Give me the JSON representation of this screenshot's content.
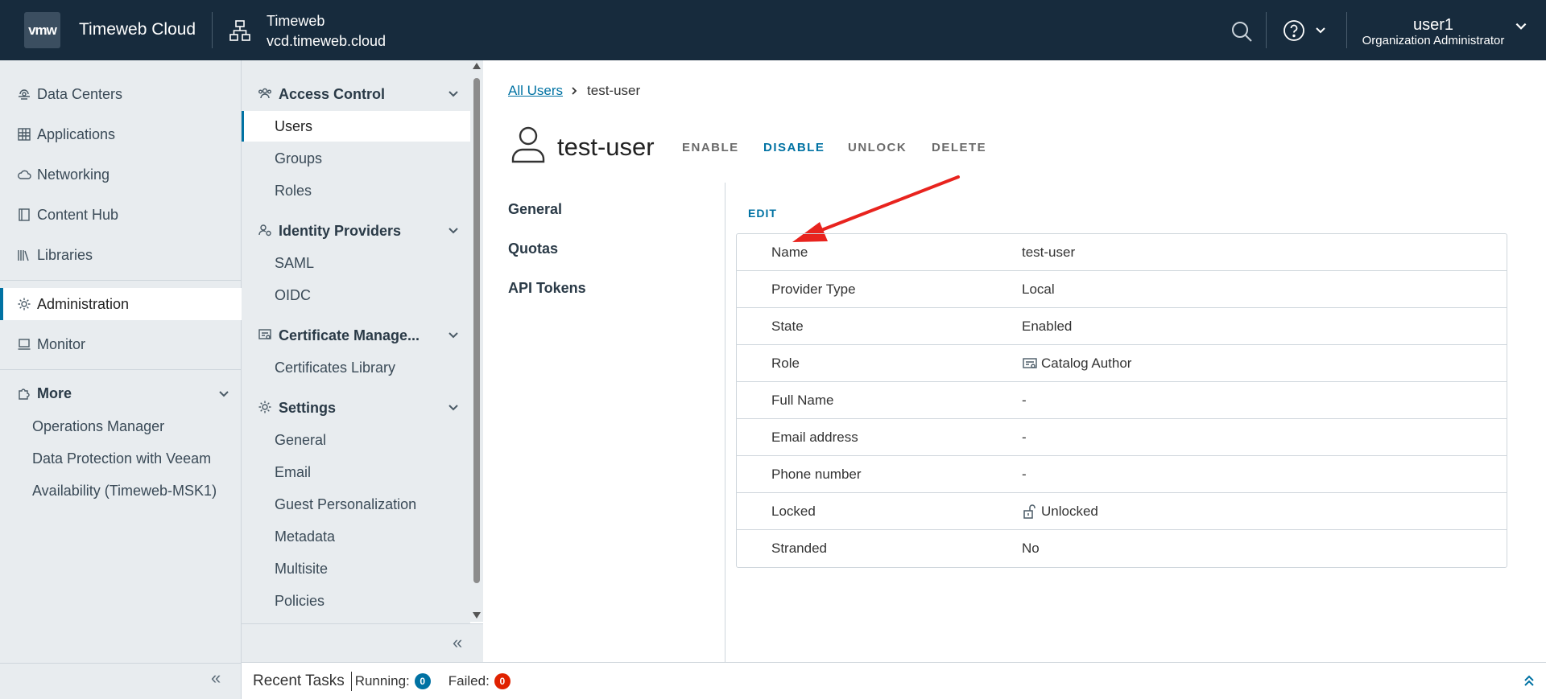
{
  "header": {
    "logo": "vmw",
    "brand": "Timeweb Cloud",
    "org_name": "Timeweb",
    "org_host": "vcd.timeweb.cloud",
    "user_name": "user1",
    "user_role": "Organization Administrator"
  },
  "leftnav": {
    "items": [
      {
        "label": "Data Centers",
        "icon": "datacenter-icon"
      },
      {
        "label": "Applications",
        "icon": "applications-icon"
      },
      {
        "label": "Networking",
        "icon": "cloud-icon"
      },
      {
        "label": "Content Hub",
        "icon": "content-hub-icon"
      },
      {
        "label": "Libraries",
        "icon": "libraries-icon"
      },
      {
        "label": "Administration",
        "icon": "gear-icon"
      },
      {
        "label": "Monitor",
        "icon": "monitor-icon"
      }
    ],
    "more": {
      "label": "More",
      "items": [
        "Operations Manager",
        "Data Protection with Veeam",
        "Availability (Timeweb-MSK1)"
      ]
    }
  },
  "subnav": {
    "access_control": {
      "label": "Access Control",
      "items": [
        "Users",
        "Groups",
        "Roles"
      ]
    },
    "identity_providers": {
      "label": "Identity Providers",
      "items": [
        "SAML",
        "OIDC"
      ]
    },
    "certificate_management": {
      "label": "Certificate Manage...",
      "items": [
        "Certificates Library"
      ]
    },
    "settings": {
      "label": "Settings",
      "items": [
        "General",
        "Email",
        "Guest Personalization",
        "Metadata",
        "Multisite",
        "Policies"
      ]
    }
  },
  "main": {
    "breadcrumb_root": "All Users",
    "breadcrumb_current": "test-user",
    "title": "test-user",
    "actions": [
      "ENABLE",
      "DISABLE",
      "UNLOCK",
      "DELETE"
    ],
    "tabs": [
      "General",
      "Quotas",
      "API Tokens"
    ],
    "edit_label": "EDIT",
    "fields": [
      {
        "key": "Name",
        "value": "test-user"
      },
      {
        "key": "Provider Type",
        "value": "Local"
      },
      {
        "key": "State",
        "value": "Enabled"
      },
      {
        "key": "Role",
        "value": "Catalog Author",
        "icon": "role-icon"
      },
      {
        "key": "Full Name",
        "value": "-"
      },
      {
        "key": "Email address",
        "value": "-"
      },
      {
        "key": "Phone number",
        "value": "-"
      },
      {
        "key": "Locked",
        "value": "Unlocked",
        "icon": "unlock-icon"
      },
      {
        "key": "Stranded",
        "value": "No"
      }
    ]
  },
  "footer": {
    "title": "Recent Tasks",
    "running_label": "Running:",
    "running_count": "0",
    "failed_label": "Failed:",
    "failed_count": "0"
  },
  "colors": {
    "header_bg": "#172b3d",
    "nav_bg": "#e8ecef",
    "accent": "#0072a3",
    "failed": "#e02200",
    "annotation_arrow": "#e8231e"
  }
}
